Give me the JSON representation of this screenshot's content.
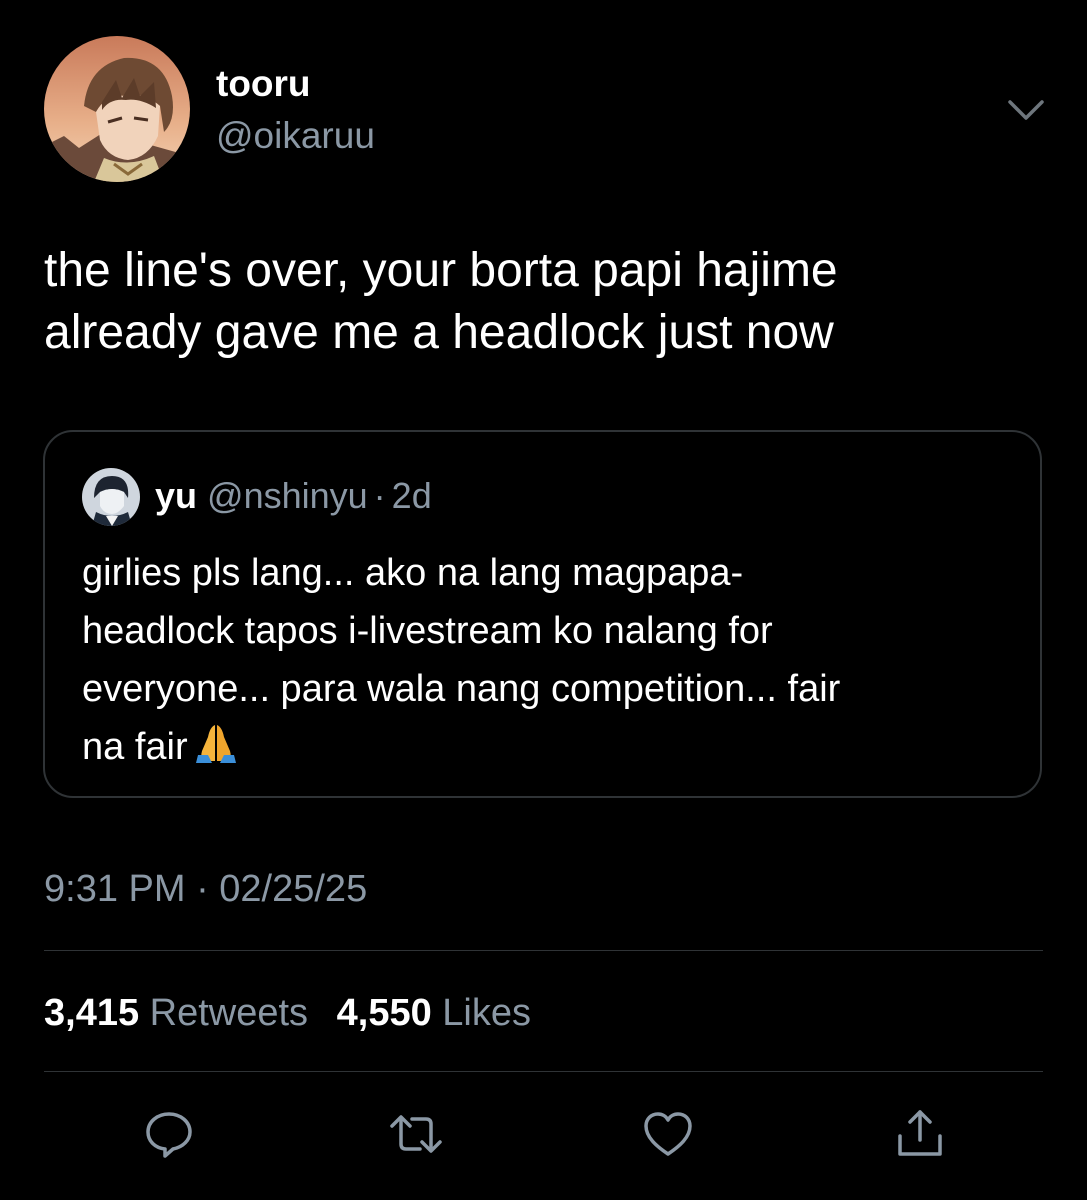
{
  "tweet": {
    "display_name": "tooru",
    "handle": "@oikaruu",
    "text_lines": [
      "the line's over, your borta papi hajime",
      "already gave me a headlock just now"
    ],
    "timestamp": "9:31 PM · 02/25/25"
  },
  "quoted": {
    "display_name": "yu",
    "handle": "@nshinyu",
    "separator": "·",
    "age": "2d",
    "text_lines": [
      "girlies pls lang... ako na lang magpapa-",
      "headlock tapos i-livestream ko nalang for",
      "everyone... para wala nang competition... fair",
      "na fair"
    ],
    "emoji": "folded-hands"
  },
  "stats": {
    "retweets_count": "3,415",
    "retweets_label": "Retweets",
    "likes_count": "4,550",
    "likes_label": "Likes"
  },
  "icons": {
    "menu": "chevron-down-icon",
    "reply": "reply-icon",
    "retweet": "retweet-icon",
    "like": "heart-icon",
    "share": "share-icon"
  },
  "colors": {
    "background": "#000000",
    "text": "#ffffff",
    "secondary_text": "#8b98a5",
    "border": "#2f3336"
  }
}
